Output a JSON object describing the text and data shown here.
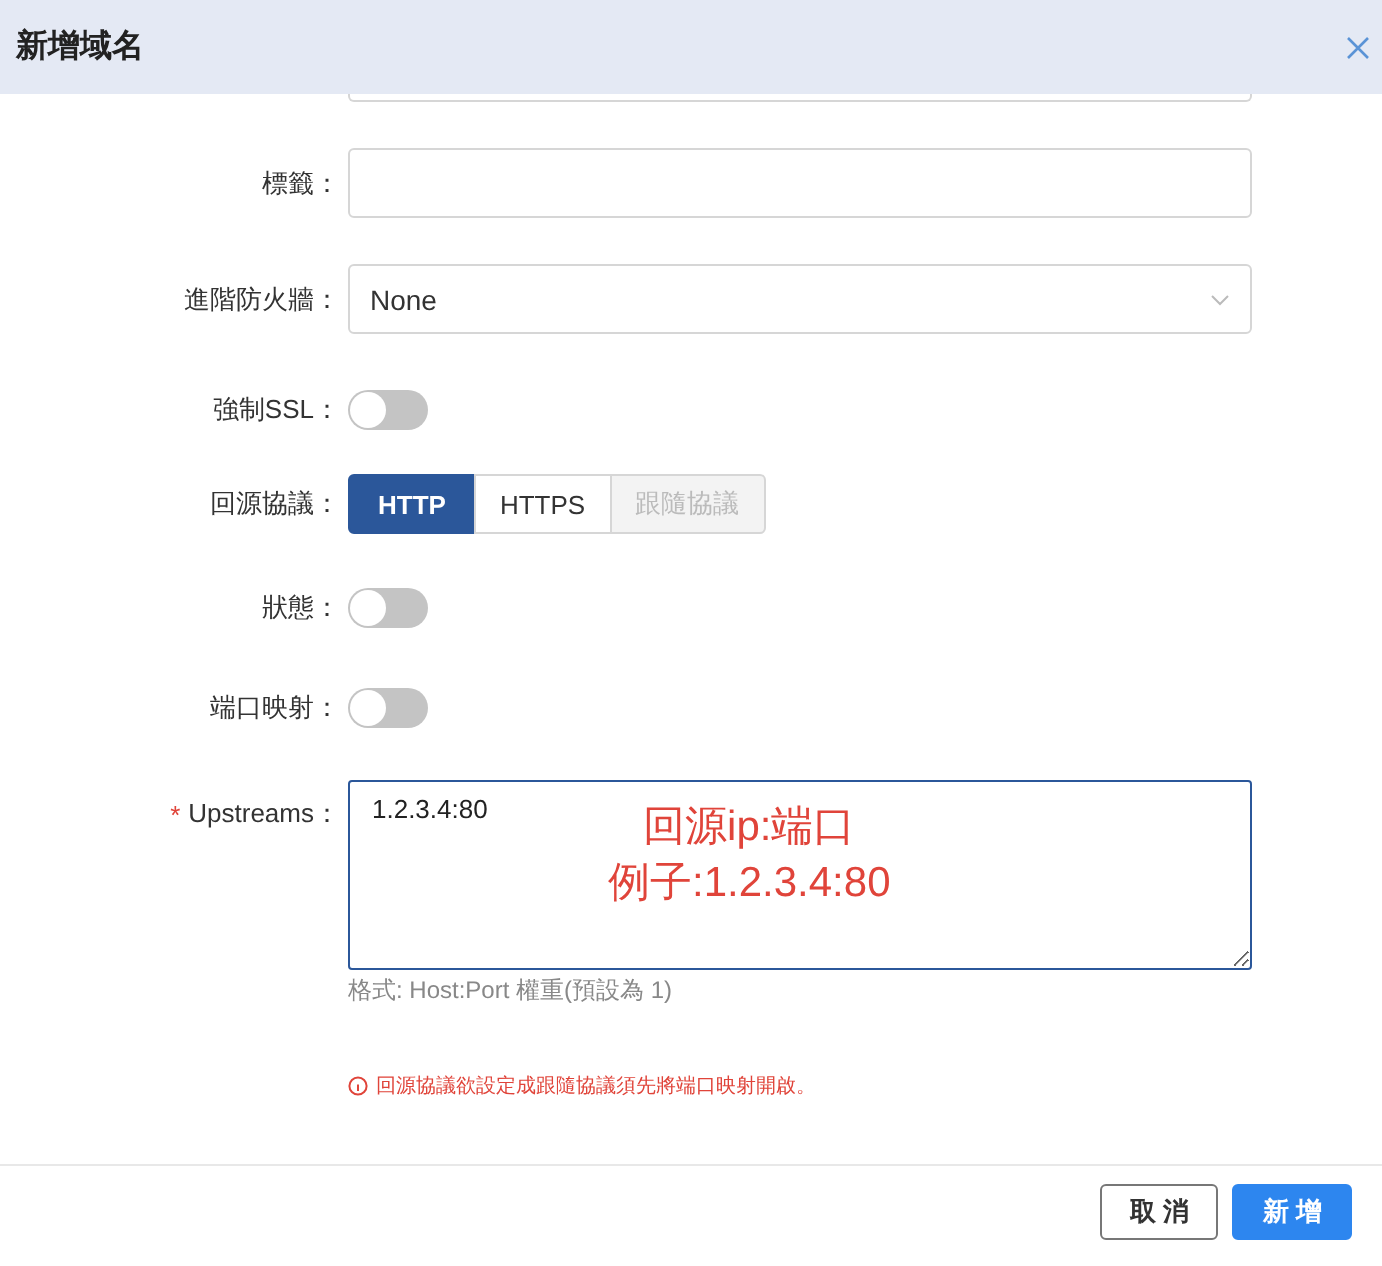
{
  "window": {
    "title": "新增域名"
  },
  "fields": [
    {
      "kind": "stub"
    },
    {
      "kind": "text",
      "label": "標籤："
    },
    {
      "kind": "select",
      "label": "進階防火牆：",
      "value": "None"
    },
    {
      "kind": "toggle",
      "label": "強制SSL：",
      "on": false
    },
    {
      "kind": "segmented",
      "label": "回源協議：",
      "options": [
        {
          "label": "HTTP",
          "selected": true,
          "disabled": false
        },
        {
          "label": "HTTPS",
          "selected": false,
          "disabled": false
        },
        {
          "label": "跟隨協議",
          "selected": false,
          "disabled": true
        }
      ]
    },
    {
      "kind": "toggle",
      "label": "狀態：",
      "on": false
    },
    {
      "kind": "toggle",
      "label": "端口映射：",
      "on": false
    },
    {
      "kind": "textarea",
      "label": "Upstreams：",
      "required_mark": "*",
      "value": "1.2.3.4:80",
      "annotation": [
        "回源ip:端口",
        "例子:1.2.3.4:80"
      ],
      "hint": "格式: Host:Port 權重(預設為 1)"
    }
  ],
  "error": "回源協議欲設定成跟隨協議須先將端口映射開啟。",
  "buttons": [
    {
      "label": "取 消",
      "kind": "secondary"
    },
    {
      "label": "新 增",
      "kind": "primary"
    }
  ]
}
